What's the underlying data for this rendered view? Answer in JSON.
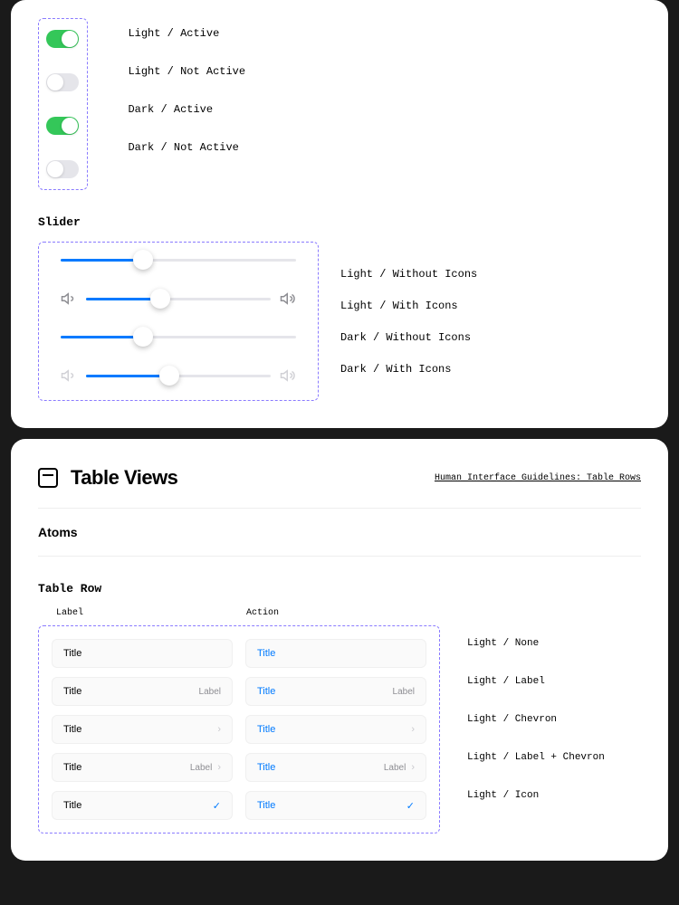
{
  "toggles": [
    {
      "label": "Light / Active",
      "on": true
    },
    {
      "label": "Light / Not Active",
      "on": false
    },
    {
      "label": "Dark / Active",
      "on": true
    },
    {
      "label": "Dark / Not Active",
      "on": false
    }
  ],
  "slider_section_title": "Slider",
  "sliders": [
    {
      "label": "Light / Without Icons",
      "icons": false,
      "fill": 35
    },
    {
      "label": "Light / With Icons",
      "icons": true,
      "fill": 40
    },
    {
      "label": "Dark / Without Icons",
      "icons": false,
      "fill": 35
    },
    {
      "label": "Dark / With Icons",
      "icons": true,
      "fill": 45
    }
  ],
  "table_views_title": "Table Views",
  "hig_link": "Human Interface Guidelines: Table Rows",
  "atoms_title": "Atoms",
  "table_row_title": "Table Row",
  "col_label": "Label",
  "col_action": "Action",
  "row_title": "Title",
  "row_label_text": "Label",
  "row_variants": [
    "Light / None",
    "Light / Label",
    "Light / Chevron",
    "Light / Label + Chevron",
    "Light / Icon"
  ]
}
